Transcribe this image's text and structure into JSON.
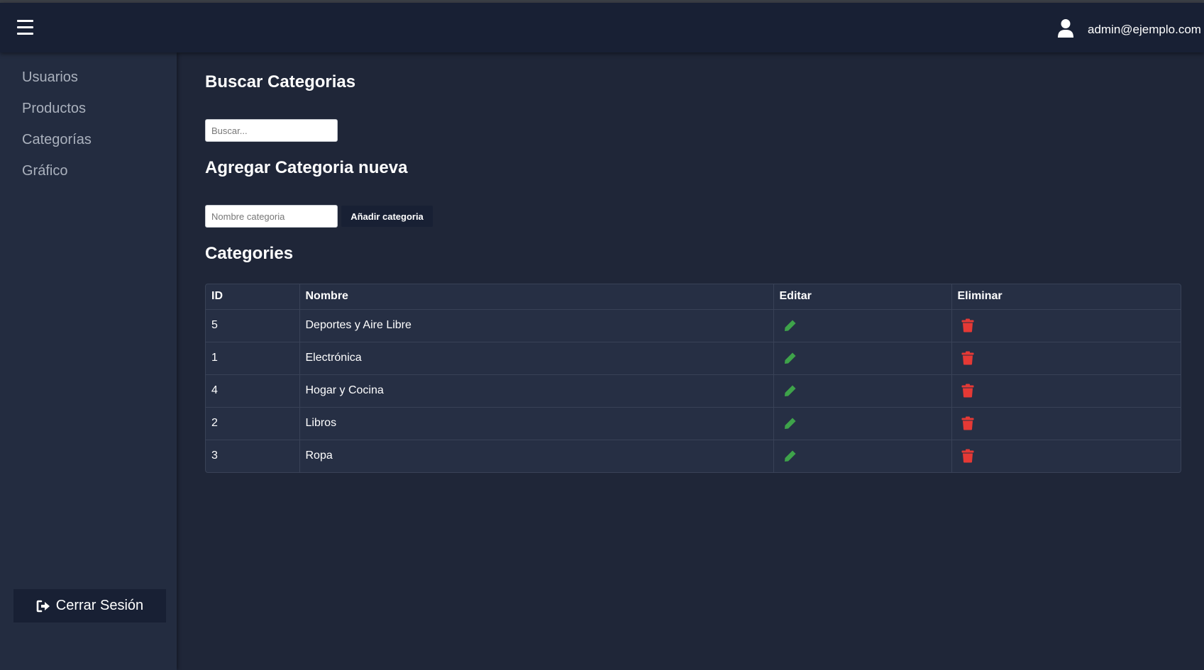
{
  "header": {
    "user_email": "admin@ejemplo.com"
  },
  "sidebar": {
    "items": [
      {
        "label": "Usuarios"
      },
      {
        "label": "Productos"
      },
      {
        "label": "Categorías"
      },
      {
        "label": "Gráfico"
      }
    ],
    "logout_label": "Cerrar Sesión"
  },
  "search": {
    "title": "Buscar Categorias",
    "placeholder": "Buscar..."
  },
  "add": {
    "title": "Agregar Categoria nueva",
    "placeholder": "Nombre categoria",
    "button_label": "Añadir categoria"
  },
  "table": {
    "title": "Categories",
    "columns": [
      "ID",
      "Nombre",
      "Editar",
      "Eliminar"
    ],
    "rows": [
      {
        "id": "5",
        "nombre": "Deportes y Aire Libre"
      },
      {
        "id": "1",
        "nombre": "Electrónica"
      },
      {
        "id": "4",
        "nombre": "Hogar y Cocina"
      },
      {
        "id": "2",
        "nombre": "Libros"
      },
      {
        "id": "3",
        "nombre": "Ropa"
      }
    ]
  },
  "colors": {
    "edit_icon": "#3ea34a",
    "delete_icon": "#e53935",
    "topbar": "#182034",
    "sidebar": "#232c40",
    "main_bg": "#1f2638"
  },
  "icons": {
    "menu": "hamburger-menu-icon",
    "user": "user-icon",
    "logout": "sign-out-icon",
    "edit": "pencil-icon",
    "delete": "trash-icon"
  }
}
